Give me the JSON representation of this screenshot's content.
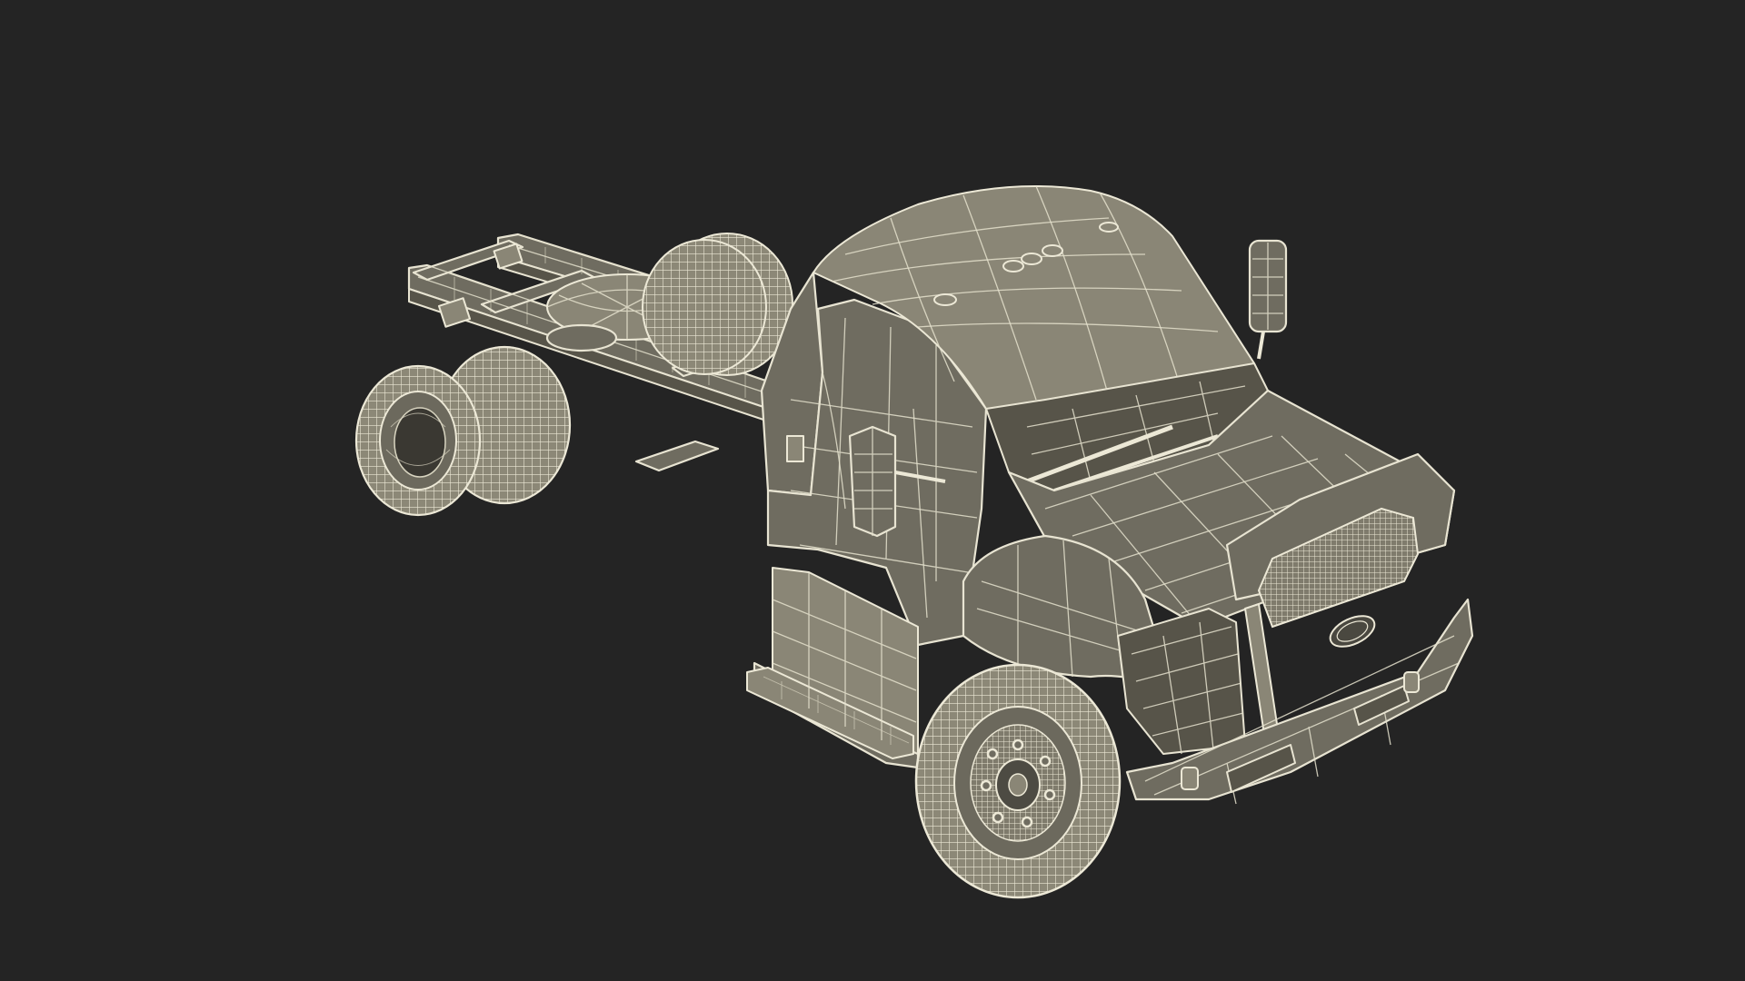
{
  "scene": {
    "background_color": "#242424",
    "model_fill_color": "#6f6c60",
    "wire_color": "#e8e4d2",
    "subject": "truck-chassis-cab-wireframe"
  }
}
